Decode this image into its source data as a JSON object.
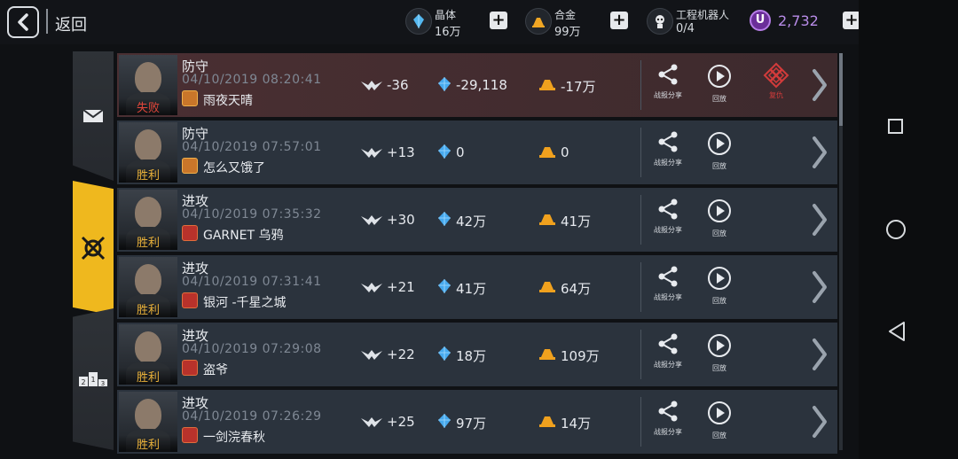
{
  "header": {
    "back_label": "返回",
    "resources": [
      {
        "name": "晶体",
        "value": "16万",
        "icon": "crystal-icon"
      },
      {
        "name": "合金",
        "value": "99万",
        "icon": "alloy-icon"
      },
      {
        "name": "工程机器人",
        "value": "0/4",
        "icon": "robot-icon"
      }
    ],
    "premium_value": "2,732",
    "premium_symbol": "U"
  },
  "tabs": [
    {
      "id": "mail",
      "icon": "envelope-icon",
      "active": false
    },
    {
      "id": "battle",
      "icon": "crossed-swords-icon",
      "active": true
    },
    {
      "id": "ranking",
      "icon": "podium-icon",
      "active": false,
      "label": "213"
    }
  ],
  "actions": {
    "share": "战报分享",
    "replay": "回放",
    "revenge": "复仇"
  },
  "rows": [
    {
      "type": "防守",
      "time": "04/10/2019 08:20:41",
      "opponent": "雨夜天晴",
      "result": "失败",
      "trophy": "-36",
      "crystal": "-29,118",
      "alloy": "-17万",
      "lost": true
    },
    {
      "type": "防守",
      "time": "04/10/2019 07:57:01",
      "opponent": "怎么又饿了",
      "result": "胜利",
      "trophy": "+13",
      "crystal": "0",
      "alloy": "0",
      "lost": false
    },
    {
      "type": "进攻",
      "time": "04/10/2019 07:35:32",
      "opponent": "GARNET 乌鸦",
      "result": "胜利",
      "trophy": "+30",
      "crystal": "42万",
      "alloy": "41万",
      "lost": false
    },
    {
      "type": "进攻",
      "time": "04/10/2019 07:31:41",
      "opponent": "银河 -千星之城",
      "result": "胜利",
      "trophy": "+21",
      "crystal": "41万",
      "alloy": "64万",
      "lost": false
    },
    {
      "type": "进攻",
      "time": "04/10/2019 07:29:08",
      "opponent": "盗爷",
      "result": "胜利",
      "trophy": "+22",
      "crystal": "18万",
      "alloy": "109万",
      "lost": false
    },
    {
      "type": "进攻",
      "time": "04/10/2019 07:26:29",
      "opponent": "一剑浣春秋",
      "result": "胜利",
      "trophy": "+25",
      "crystal": "97万",
      "alloy": "14万",
      "lost": false
    }
  ],
  "colors": {
    "accent": "#efb81e",
    "loss": "#e2473b",
    "premium": "#b88ce8"
  }
}
